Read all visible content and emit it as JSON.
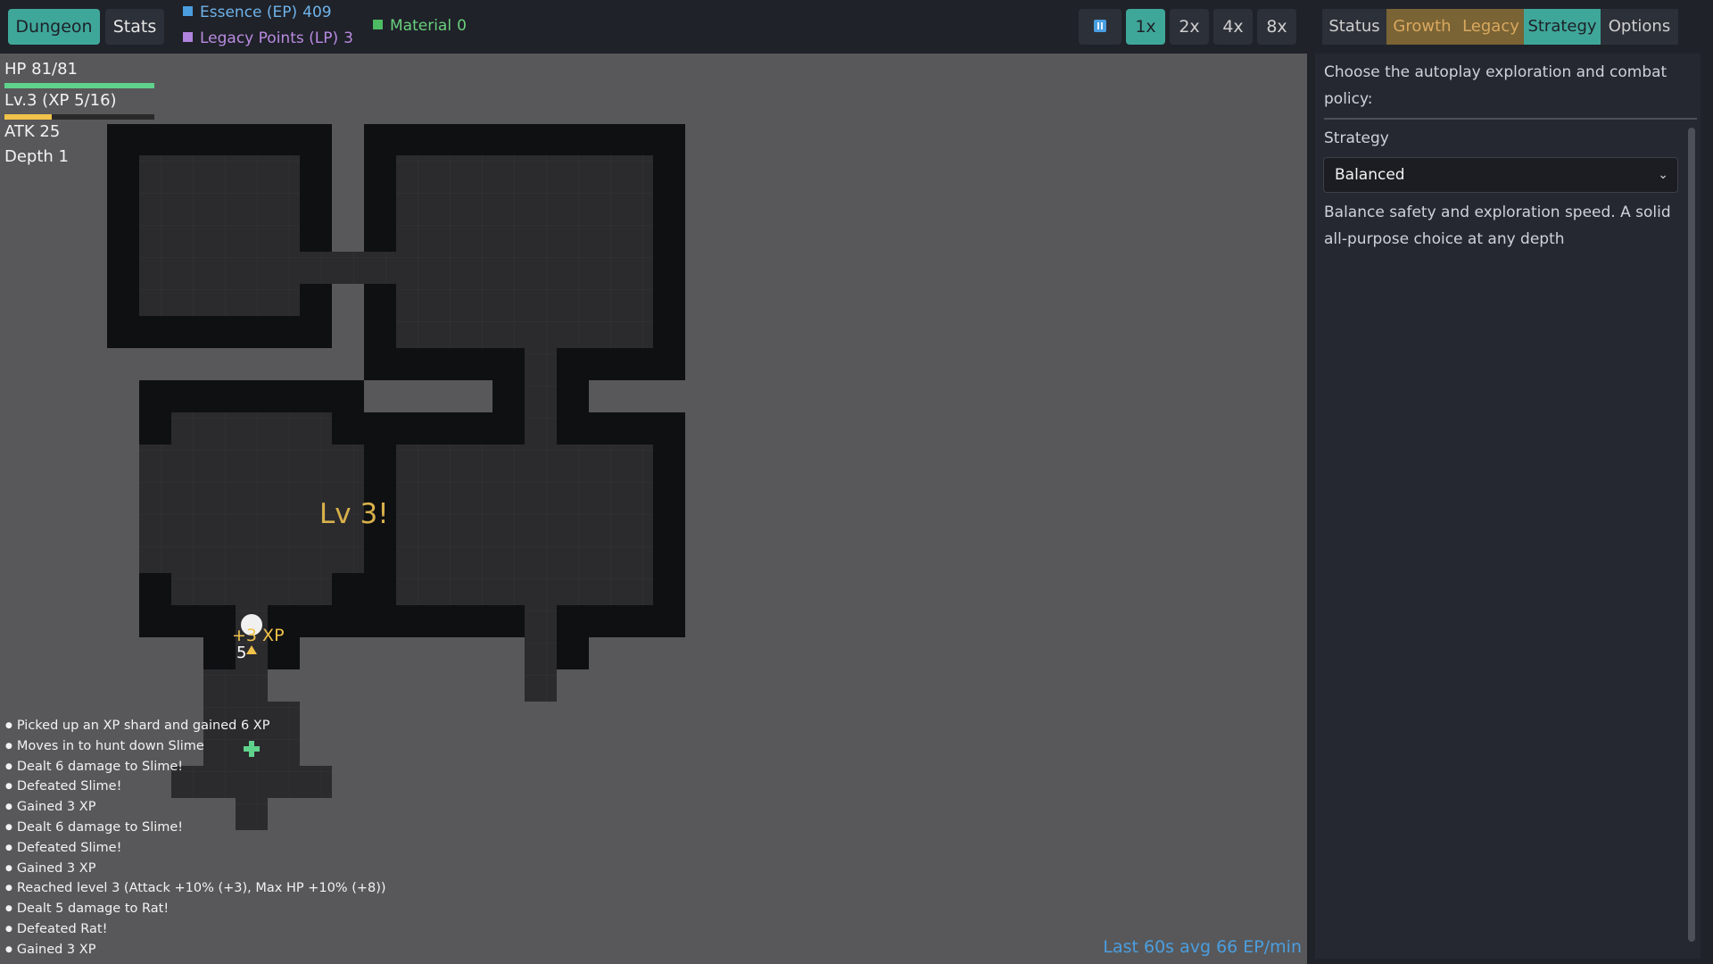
{
  "topbar": {
    "dungeon_label": "Dungeon",
    "stats_label": "Stats",
    "essence": {
      "label": "Essence (EP)",
      "value": "409",
      "color": "#4a9ee0"
    },
    "legacy": {
      "label": "Legacy Points (LP)",
      "value": "3",
      "color": "#b084de"
    },
    "material": {
      "label": "Material",
      "value": "0",
      "color": "#4dbb63"
    },
    "speeds": [
      "1x",
      "2x",
      "4x",
      "8x"
    ],
    "active_speed": "1x"
  },
  "player": {
    "hp_text": "HP 81/81",
    "hp_fraction": 1.0,
    "level_text": "Lv.3 (XP 5/16)",
    "xp_fraction": 0.3125,
    "atk_text": "ATK 25",
    "depth_text": "Depth 1"
  },
  "map": {
    "popups": {
      "level_up": "Lv 3!",
      "xp_gain": "+3 XP",
      "number": "5"
    },
    "colors": {
      "wall": "#0f1012",
      "floor": "#2b2b2e",
      "background": "#58585a"
    }
  },
  "log": [
    "Picked up an XP shard and gained 6 XP",
    "Moves in to hunt down Slime",
    "Dealt 6 damage to Slime!",
    "Defeated Slime!",
    "Gained 3 XP",
    "Dealt 6 damage to Slime!",
    "Defeated Slime!",
    "Gained 3 XP",
    "Reached level 3 (Attack +10% (+3), Max HP +10% (+8))",
    "Dealt 5 damage to Rat!",
    "Defeated Rat!",
    "Gained 3 XP"
  ],
  "rate_text": "Last 60s avg 66 EP/min",
  "panel": {
    "tabs": [
      "Status",
      "Growth",
      "Legacy",
      "Strategy",
      "Options"
    ],
    "active_tab": "Strategy",
    "description": "Choose the autoplay exploration and combat policy:",
    "strategy_label": "Strategy",
    "strategy_value": "Balanced",
    "strategy_help": "Balance safety and exploration speed. A solid all-purpose choice at any depth"
  },
  "icons": [
    "pause-icon",
    "chevron-down-icon",
    "player-token",
    "trap-icon",
    "heal-cross-icon"
  ]
}
